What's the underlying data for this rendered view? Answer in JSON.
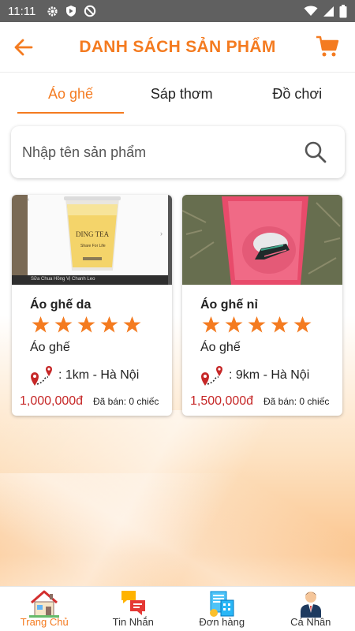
{
  "status_bar": {
    "time": "11:11"
  },
  "header": {
    "title": "DANH SÁCH SẢN PHẨM"
  },
  "tabs": [
    {
      "label": "Áo ghế",
      "active": true
    },
    {
      "label": "Sáp thơm",
      "active": false
    },
    {
      "label": "Đồ chơi",
      "active": false
    }
  ],
  "search": {
    "placeholder": "Nhập tên sản phẩm",
    "value": ""
  },
  "products": [
    {
      "name": "Áo ghế da",
      "rating": 5,
      "category": "Áo ghế",
      "location": ": 1km - Hà Nội",
      "price": "1,000,000đ",
      "sold": "Đã bán: 0 chiếc",
      "image_caption": "Sữa Chua Hồng Vị Chanh Leo",
      "image_brand": "DING TEA",
      "image_brand_sub": "Share For Life"
    },
    {
      "name": "Áo ghế nỉ",
      "rating": 5,
      "category": "Áo ghế",
      "location": ": 9km - Hà Nội",
      "price": "1,500,000đ",
      "sold": "Đã bán: 0 chiếc"
    }
  ],
  "bottom_nav": [
    {
      "label": "Trang Chủ",
      "icon": "home-icon",
      "active": true
    },
    {
      "label": "Tin Nhắn",
      "icon": "chat-icon",
      "active": false
    },
    {
      "label": "Đơn hàng",
      "icon": "orders-icon",
      "active": false
    },
    {
      "label": "Cá Nhân",
      "icon": "profile-icon",
      "active": false
    }
  ],
  "colors": {
    "accent": "#f47b20",
    "price": "#c62828",
    "status_bar": "#606060",
    "star": "#f47b20"
  }
}
